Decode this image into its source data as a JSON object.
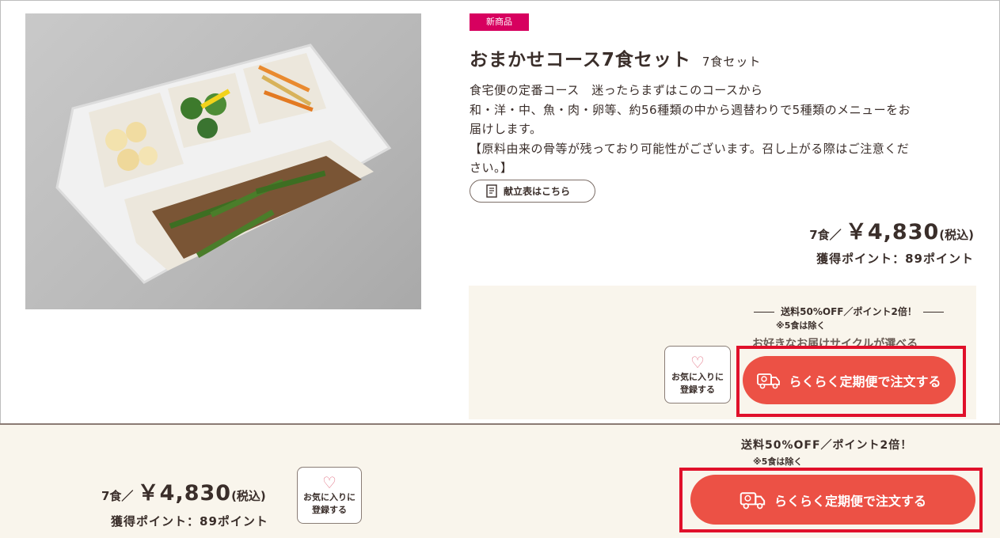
{
  "product": {
    "badge": "新商品",
    "title": "おまかせコース7食セット",
    "subtitle": "7食セット",
    "description": [
      "食宅便の定番コース　迷ったらまずはこのコースから",
      "和・洋・中、魚・肉・卵等、約56種類の中から週替わりで5種類のメニューをお",
      "届けします。",
      "【原料由来の骨等が残っており可能性がございます。召し上がる際はご注意くだ",
      "さい。】"
    ],
    "menu_button": "献立表はこちら",
    "price_prefix": "7食／",
    "price": "￥4,830",
    "tax_label": "(税込)",
    "points": "獲得ポイント：89ポイント"
  },
  "promo": {
    "headline": "送料50%OFF／ポイント2倍！",
    "note": "※5食は除く",
    "subline": "お好きなお届けサイクルが選べる"
  },
  "favorite": {
    "line1": "お気に入りに",
    "line2": "登録する"
  },
  "order_button": "らくらく定期便で注文する",
  "bottom_bar": {
    "price_prefix": "7食／",
    "price": "￥4,830",
    "tax_label": "(税込)",
    "points": "獲得ポイント：89ポイント",
    "promo": "送料50%OFF／ポイント2倍！",
    "note": "※5食は除く",
    "order_button": "らくらく定期便で注文する"
  },
  "colors": {
    "badge": "#d7005f",
    "order_button": "#ec5145",
    "highlight_outline": "#e0102a",
    "promo_background": "#f9f5ec"
  }
}
